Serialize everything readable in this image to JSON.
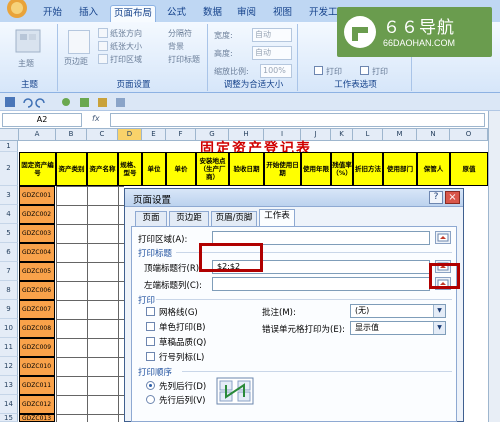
{
  "ribbon": {
    "tabs": [
      "开始",
      "插入",
      "页面布局",
      "公式",
      "数据",
      "审阅",
      "视图",
      "开发工具"
    ],
    "active_tab": "页面布局",
    "groups": {
      "theme": {
        "label": "主题",
        "button": "主题"
      },
      "page_setup": {
        "label": "页面设置",
        "items": [
          "页边距",
          "纸张方向",
          "纸张大小",
          "打印区域",
          "分隔符",
          "背景",
          "打印标题"
        ]
      },
      "scale": {
        "label": "调整为合适大小",
        "width_label": "宽度:",
        "width_value": "自动",
        "height_label": "高度:",
        "height_value": "自动",
        "scale_label": "缩放比例:",
        "scale_value": "100%"
      },
      "sheet_options": {
        "label": "工作表选项",
        "print_1": "打印",
        "print_2": "打印"
      }
    }
  },
  "watermark": {
    "title": "６６导航",
    "subtitle": "66DAOHAN.COM"
  },
  "formula_bar": {
    "name_box": "A2",
    "fx": "fx"
  },
  "sheet": {
    "title": "固定资产登记表",
    "columns": [
      "A",
      "B",
      "C",
      "D",
      "E",
      "F",
      "G",
      "H",
      "I",
      "J",
      "K",
      "L",
      "M",
      "N",
      "O"
    ],
    "rows": [
      "1",
      "2",
      "3",
      "4",
      "5",
      "6",
      "7",
      "8",
      "9",
      "10",
      "11",
      "12",
      "13",
      "14",
      "15",
      "16",
      "17"
    ],
    "headers": [
      "固定资产编号",
      "资产类别",
      "资产名称",
      "规格、型号",
      "单位",
      "单价",
      "数量",
      "原值",
      "安装地点（生产厂商）",
      "验收日期",
      "开始使用日期",
      "使用年限",
      "残值率（%）",
      "折旧方法",
      "使用部门",
      "保管人"
    ],
    "ids": [
      "GDZC001",
      "GDZC002",
      "GDZC003",
      "GDZC004",
      "GDZC005",
      "GDZC006",
      "GDZC007",
      "GDZC008",
      "GDZC009",
      "GDZC010",
      "GDZC011",
      "GDZC012",
      "GDZC013"
    ]
  },
  "dialog": {
    "title": "页面设置",
    "help": "?",
    "close": "×",
    "tabs": [
      "页面",
      "页边距",
      "页眉/页脚",
      "工作表"
    ],
    "active_tab": "工作表",
    "print_area_label": "打印区域(A):",
    "print_titles_label": "打印标题",
    "rows_repeat_label": "顶端标题行(R):",
    "rows_repeat_value": "$2:$2",
    "cols_repeat_label": "左端标题列(C):",
    "cols_repeat_value": "",
    "print_section": "打印",
    "checkboxes": [
      "网格线(G)",
      "单色打印(B)",
      "草稿品质(Q)",
      "行号列标(L)"
    ],
    "comments_label": "批注(M):",
    "comments_value": "(无)",
    "errors_label": "错误单元格打印为(E):",
    "errors_value": "显示值",
    "order_section": "打印顺序",
    "order_options": [
      "先列后行(D)",
      "先行后列(V)"
    ],
    "order_selected": "先列后行(D)"
  },
  "colors": {
    "highlight": "#b00000",
    "header_fill": "#ffff00",
    "id_fill": "#f9a24a",
    "title_red": "#d00000"
  }
}
